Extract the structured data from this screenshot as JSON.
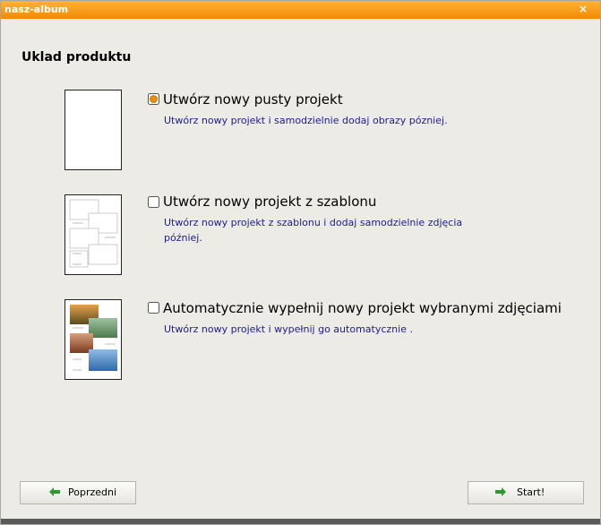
{
  "window": {
    "title": "nasz-album",
    "close_label": "×"
  },
  "heading": "Uklad produktu",
  "options": [
    {
      "title": "Utwórz nowy pusty projekt",
      "description": "Utwórz nowy projekt i samodzielnie dodaj obrazy pózniej.",
      "selected": true
    },
    {
      "title": "Utwórz nowy projekt z szablonu",
      "description": "Utwórz nowy projekt z szablonu i dodaj samodzielnie zdjęcia później.",
      "selected": false
    },
    {
      "title": "Automatycznie wypełnij nowy projekt wybranymi zdjęciami",
      "description": "Utwórz nowy projekt i wypełnij go automatycznie .",
      "selected": false
    }
  ],
  "buttons": {
    "back": "Poprzedni",
    "start": "Start!"
  },
  "colors": {
    "accent": "#f28a00",
    "description_text": "#1d1d8c",
    "arrow_green": "#2c9a2c"
  }
}
